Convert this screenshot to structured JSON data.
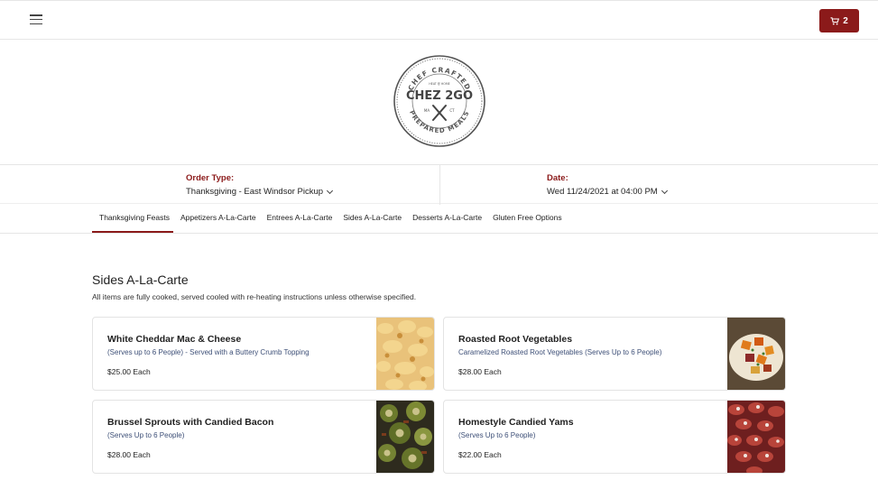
{
  "header": {
    "menu_icon": "hamburger-menu-icon",
    "cart_icon": "shopping-cart-icon",
    "cart_count": "2",
    "accent_color": "#8b1a1a"
  },
  "logo": {
    "top_text": "CHEF CRAFTED",
    "small_text": "HEAT @ HOME",
    "brand": "CHEZ 2GO",
    "left_state": "MA",
    "right_state": "CT",
    "bottom_text": "PREPARED MEALS"
  },
  "order": {
    "type_label": "Order Type:",
    "type_value": "Thanksgiving - East Windsor Pickup",
    "date_label": "Date:",
    "date_value": "Wed 11/24/2021 at 04:00 PM"
  },
  "tabs": [
    {
      "label": "Thanksgiving Feasts",
      "active": true
    },
    {
      "label": "Appetizers A-La-Carte",
      "active": false
    },
    {
      "label": "Entrees A-La-Carte",
      "active": false
    },
    {
      "label": "Sides A-La-Carte",
      "active": false
    },
    {
      "label": "Desserts A-La-Carte",
      "active": false
    },
    {
      "label": "Gluten Free Options",
      "active": false
    }
  ],
  "section": {
    "title": "Sides A-La-Carte",
    "description": "All items are fully cooked, served cooled with re-heating instructions unless otherwise specified."
  },
  "items": [
    {
      "name": "White Cheddar Mac & Cheese",
      "description": "(Serves up to 6 People) - Served with a Buttery Crumb Topping",
      "price": "$25.00 Each"
    },
    {
      "name": "Roasted Root Vegetables",
      "description": "Caramelized Roasted Root Vegetables (Serves Up to 6 People)",
      "price": "$28.00 Each"
    },
    {
      "name": "Brussel Sprouts with Candied Bacon",
      "description": "(Serves Up to 6 People)",
      "price": "$28.00 Each"
    },
    {
      "name": "Homestyle Candied Yams",
      "description": "(Serves Up to 6 People)",
      "price": "$22.00 Each"
    }
  ]
}
